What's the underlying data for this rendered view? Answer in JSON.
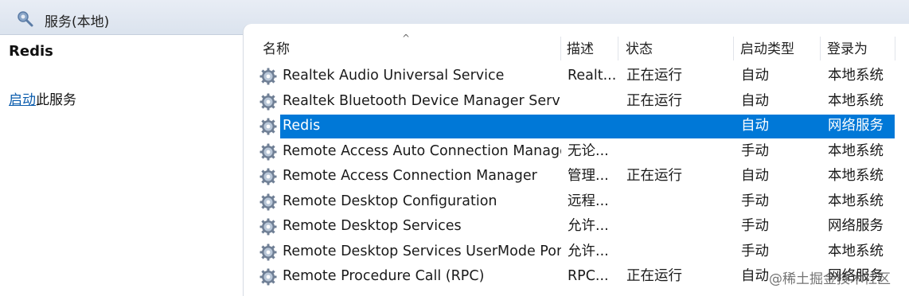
{
  "window": {
    "title": "服务(本地)",
    "icon": "gear-search-icon"
  },
  "left_pane": {
    "service_name": "Redis",
    "action_link": "启动",
    "action_suffix": "此服务"
  },
  "list": {
    "columns": [
      "名称",
      "描述",
      "状态",
      "启动类型",
      "登录为"
    ],
    "sort_indicator": "^",
    "rows": [
      {
        "name": "Realtek Audio Universal Service",
        "desc": "Realt...",
        "status": "正在运行",
        "startup": "自动",
        "logon": "本地系统"
      },
      {
        "name": "Realtek Bluetooth Device Manager Servi...",
        "desc": "",
        "status": "正在运行",
        "startup": "自动",
        "logon": "本地系统"
      },
      {
        "name": "Redis",
        "desc": "",
        "status": "",
        "startup": "自动",
        "logon": "网络服务",
        "selected": true
      },
      {
        "name": "Remote Access Auto Connection Manager",
        "desc": "无论...",
        "status": "",
        "startup": "手动",
        "logon": "本地系统"
      },
      {
        "name": "Remote Access Connection Manager",
        "desc": "管理...",
        "status": "正在运行",
        "startup": "自动",
        "logon": "本地系统"
      },
      {
        "name": "Remote Desktop Configuration",
        "desc": "远程...",
        "status": "",
        "startup": "手动",
        "logon": "本地系统"
      },
      {
        "name": "Remote Desktop Services",
        "desc": "允许...",
        "status": "",
        "startup": "手动",
        "logon": "网络服务"
      },
      {
        "name": "Remote Desktop Services UserMode Por...",
        "desc": "允许...",
        "status": "",
        "startup": "手动",
        "logon": "本地系统"
      },
      {
        "name": "Remote Procedure Call (RPC)",
        "desc": "RPC...",
        "status": "正在运行",
        "startup": "自动",
        "logon": "网络服务"
      }
    ]
  },
  "watermark": "@稀土掘金技术社区",
  "colors": {
    "selection": "#0078d7",
    "link": "#0b5cad",
    "titlebar": "#dbe3ee"
  }
}
